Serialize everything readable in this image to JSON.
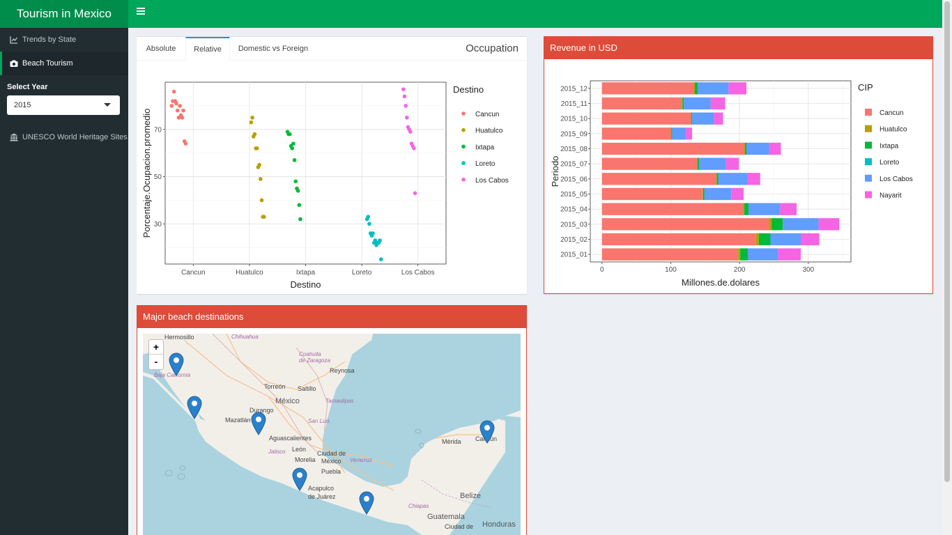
{
  "app": {
    "title": "Tourism in Mexico"
  },
  "sidebar": {
    "items": [
      {
        "label": "Trends by State",
        "icon": "line-chart-icon"
      },
      {
        "label": "Beach Tourism",
        "icon": "camera-icon"
      }
    ],
    "select_label": "Select Year",
    "select_value": "2015",
    "extra_item": {
      "label": "UNESCO World Heritage Sites",
      "icon": "institution-icon"
    }
  },
  "occupation": {
    "tabs": [
      "Absolute",
      "Relative",
      "Domestic vs Foreign"
    ],
    "active_tab": "Relative",
    "title": "Occupation"
  },
  "revenue": {
    "title": "Revenue in USD"
  },
  "map_box": {
    "title": "Major beach destinations",
    "zoom_in": "+",
    "zoom_out": "-",
    "labels": {
      "hermosillo": "Hermosillo",
      "chihuahua": "Chihuahua",
      "coahuila": "Coahuila\nde Zaragoza",
      "reynosa": "Reynosa",
      "torreon": "Torreón",
      "saltillo": "Saltillo",
      "mexico": "México",
      "durango": "Durango",
      "tamaulipas": "Tamaulipas",
      "mazatlan": "Mazatlán",
      "sanluis": "San Luis",
      "aguascalientes": "Aguascalientes",
      "leon": "León",
      "merida": "Mérida",
      "cancun": "Cancún",
      "ciudad": "Ciudad de",
      "mexico2": "México",
      "morelia": "Morelia",
      "puebla": "Puebla",
      "veracruz": "Veracruz",
      "acapulco": "Acapulco",
      "dejuarez": "de Juárez",
      "chiapas": "Chiapas",
      "belize": "Belize",
      "guatemala": "Guatemala",
      "honduras": "Honduras",
      "ciudadguat": "Ciudad de",
      "bajacal": "Baja California",
      "jalisco": "Jalisco"
    }
  },
  "colors": {
    "Cancun": "#F8766D",
    "Huatulco": "#B79F00",
    "Ixtapa": "#00BA38",
    "Ixtapa_dots": "#00BA38",
    "Loreto": "#00BFC4",
    "Los Cabos": "#619CFF",
    "Nayarit": "#F564E3"
  },
  "chart_data": [
    {
      "type": "scatter",
      "xlabel": "Destino",
      "ylabel": "Porcentaje.Ocupacion.promedio",
      "legend_title": "Destino",
      "categories": [
        "Cancun",
        "Huatulco",
        "Ixtapa",
        "Loreto",
        "Los Cabos"
      ],
      "yticks": [
        30,
        50,
        70
      ],
      "ylim": [
        13,
        90
      ],
      "legend": "right",
      "series": [
        {
          "name": "Cancun",
          "color": "#F8766D",
          "values": [
            80,
            82,
            86,
            82,
            81,
            78,
            75,
            80,
            76,
            75,
            78,
            65,
            64
          ]
        },
        {
          "name": "Huatulco",
          "color": "#B79F00",
          "values": [
            73,
            75,
            67,
            68,
            62,
            62,
            54,
            55,
            49,
            40,
            33,
            33
          ]
        },
        {
          "name": "Ixtapa",
          "color": "#00BA38",
          "values": [
            69,
            68,
            68,
            63,
            62,
            64,
            57,
            48,
            45,
            44,
            38,
            32
          ]
        },
        {
          "name": "Loreto",
          "color": "#00BFC4",
          "values": [
            32,
            33,
            30,
            26,
            25,
            26,
            22,
            23,
            21,
            22,
            22,
            23,
            15
          ]
        },
        {
          "name": "Los Cabos",
          "color": "#F564E3",
          "values": [
            87,
            84,
            80,
            75,
            71,
            70,
            69,
            64,
            63,
            62,
            43
          ]
        }
      ]
    },
    {
      "type": "bar",
      "orientation": "horizontal",
      "stacked": true,
      "xlabel": "Millones.de.dolares",
      "ylabel": "Periodo",
      "legend_title": "CIP",
      "legend": "right",
      "xticks": [
        0,
        100,
        200,
        300
      ],
      "xlim": [
        -17,
        362
      ],
      "categories": [
        "2015_12",
        "2015_11",
        "2015_10",
        "2015_09",
        "2015_08",
        "2015_07",
        "2015_06",
        "2015_05",
        "2015_04",
        "2015_03",
        "2015_02",
        "2015_01"
      ],
      "series": [
        {
          "name": "Cancun",
          "color": "#F8766D",
          "values": [
            134,
            116,
            129,
            100,
            207,
            138,
            166,
            146,
            205,
            243,
            224,
            198
          ]
        },
        {
          "name": "Huatulco",
          "color": "#B79F00",
          "values": [
            1,
            1,
            1,
            1,
            1,
            1,
            1,
            1,
            2,
            4,
            4,
            3
          ]
        },
        {
          "name": "Ixtapa",
          "color": "#00BA38",
          "values": [
            4,
            2,
            1,
            1,
            2,
            2,
            2,
            2,
            6,
            16,
            17,
            11
          ]
        },
        {
          "name": "Loreto",
          "color": "#00BFC4",
          "values": [
            0,
            0,
            0,
            0,
            0,
            0,
            0,
            0,
            0,
            0,
            0,
            0
          ]
        },
        {
          "name": "Los Cabos",
          "color": "#619CFF",
          "values": [
            45,
            39,
            32,
            20,
            33,
            39,
            42,
            39,
            46,
            52,
            44,
            44
          ]
        },
        {
          "name": "Nayarit",
          "color": "#F564E3",
          "values": [
            26,
            21,
            13,
            9,
            17,
            19,
            19,
            18,
            24,
            30,
            27,
            33
          ]
        }
      ]
    }
  ]
}
